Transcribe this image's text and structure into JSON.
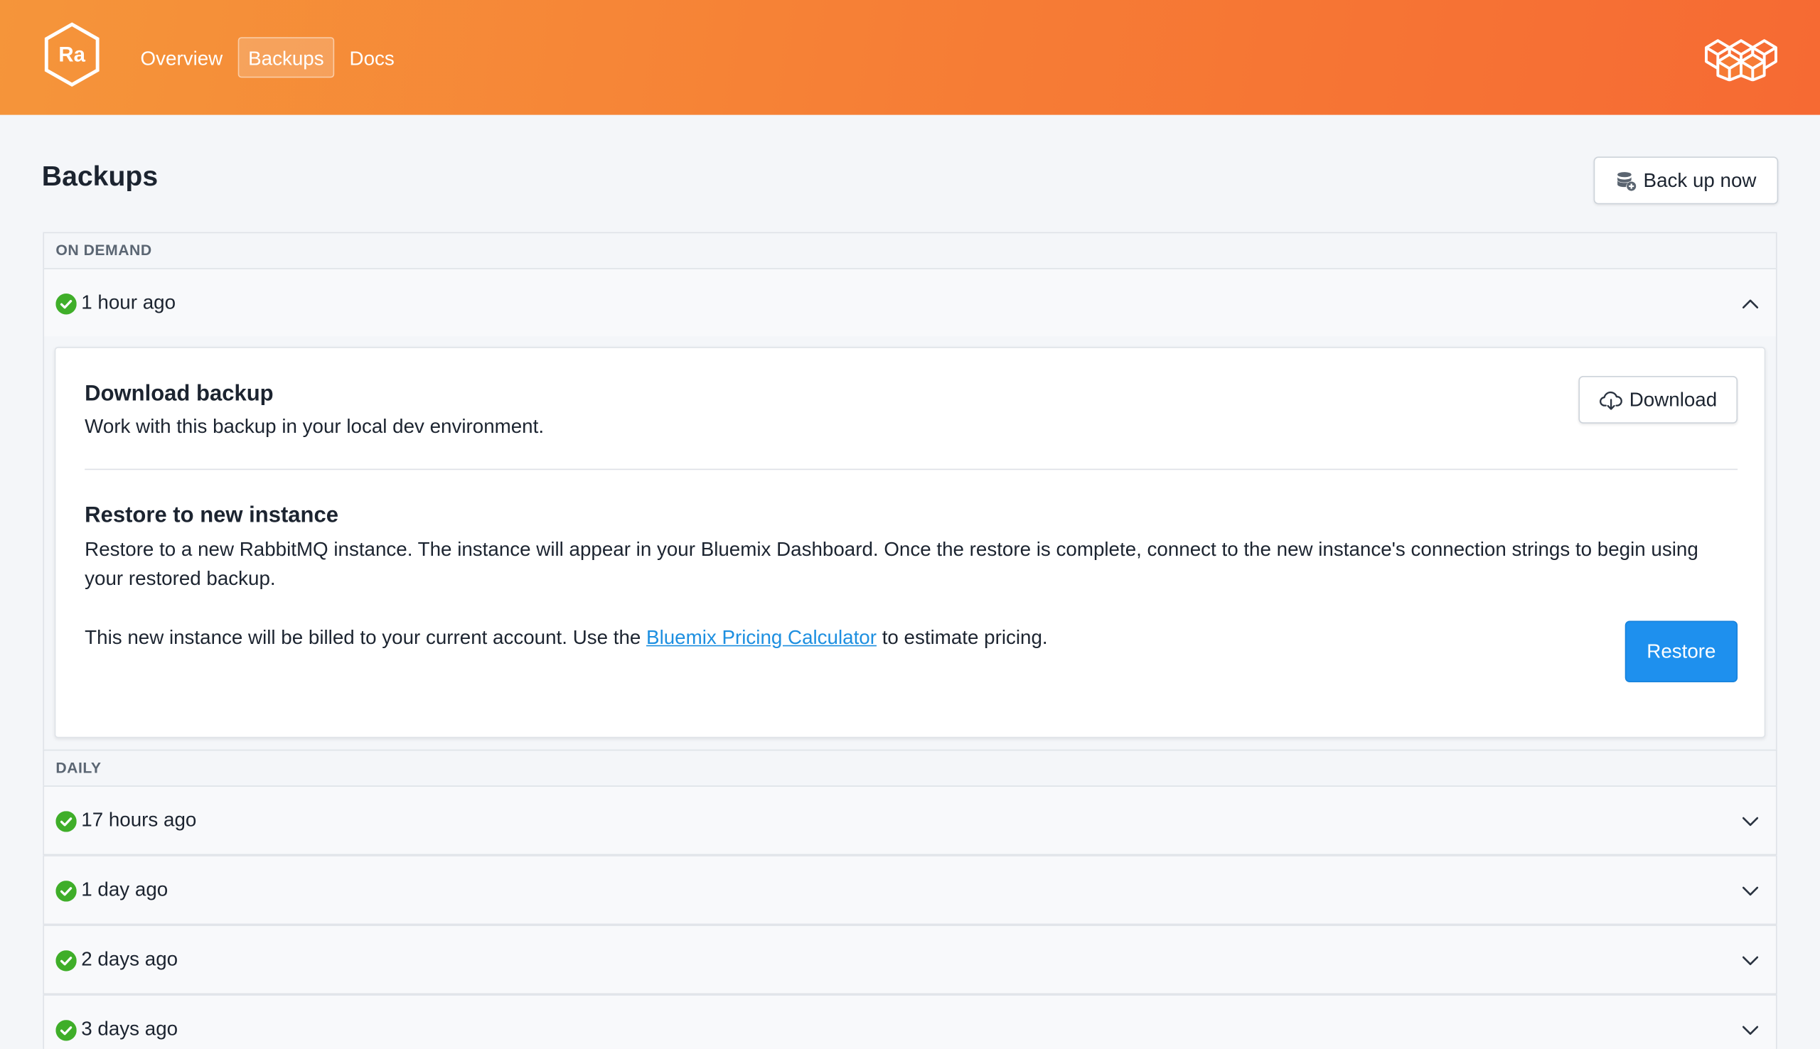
{
  "header": {
    "logo_text": "Ra",
    "nav": [
      {
        "label": "Overview",
        "active": false
      },
      {
        "label": "Backups",
        "active": true
      },
      {
        "label": "Docs",
        "active": false
      }
    ],
    "icon_right": "cubes-icon"
  },
  "page": {
    "title": "Backups",
    "backup_now_label": "Back up now"
  },
  "sections": {
    "on_demand": {
      "label": "ON DEMAND",
      "items": [
        {
          "label": "1 hour ago",
          "status": "success",
          "expanded": true
        }
      ]
    },
    "daily": {
      "label": "DAILY",
      "items": [
        {
          "label": "17 hours ago",
          "status": "success",
          "expanded": false
        },
        {
          "label": "1 day ago",
          "status": "success",
          "expanded": false
        },
        {
          "label": "2 days ago",
          "status": "success",
          "expanded": false
        },
        {
          "label": "3 days ago",
          "status": "success",
          "expanded": false
        }
      ]
    }
  },
  "detail": {
    "download_title": "Download backup",
    "download_desc": "Work with this backup in your local dev environment.",
    "download_button": "Download",
    "restore_title": "Restore to new instance",
    "restore_desc": "Restore to a new RabbitMQ instance. The instance will appear in your Bluemix Dashboard. Once the restore is complete, connect to the new instance's connection strings to begin using your restored backup.",
    "billing_prefix": "This new instance will be billed to your current account. Use the ",
    "billing_link": "Bluemix Pricing Calculator",
    "billing_suffix": " to estimate pricing.",
    "restore_button": "Restore"
  },
  "colors": {
    "header_start": "#f5953a",
    "header_end": "#f66a33",
    "success": "#3fae29",
    "primary": "#1e90ee",
    "link": "#1d8fe0"
  }
}
